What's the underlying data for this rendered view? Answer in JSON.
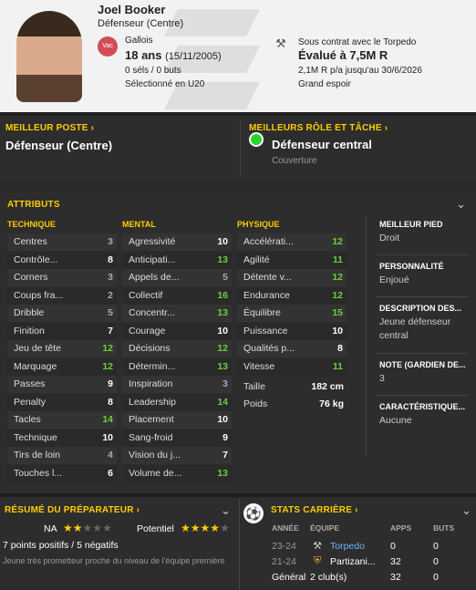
{
  "header": {
    "name": "Joel Booker",
    "position": "Défenseur (Centre)",
    "flag_label": "Vac",
    "nationality": "Gallois",
    "age": "18 ans",
    "dob": "(15/11/2005)",
    "games": "0 séls / 0 buts",
    "selection": "Sélectionné en U20",
    "contract": "Sous contrat avec le Torpedo",
    "value": "Évalué à 7,5M R",
    "wage": "2,1M R p/a jusqu'au 30/6/2026",
    "status": "Grand espoir"
  },
  "best_position": {
    "title": "MEILLEUR POSTE",
    "value": "Défenseur (Centre)"
  },
  "best_role": {
    "title": "MEILLEURS RÔLE ET TÂCHE",
    "role": "Défenseur central",
    "duty": "Couverture"
  },
  "attributes": {
    "title": "ATTRIBUTS",
    "technique": {
      "title": "TECHNIQUE",
      "rows": [
        {
          "label": "Centres",
          "value": "3",
          "tone": "grey"
        },
        {
          "label": "Contrôle...",
          "value": "8",
          "tone": "white"
        },
        {
          "label": "Corners",
          "value": "3",
          "tone": "grey"
        },
        {
          "label": "Coups fra...",
          "value": "2",
          "tone": "grey"
        },
        {
          "label": "Dribble",
          "value": "5",
          "tone": "grey"
        },
        {
          "label": "Finition",
          "value": "7",
          "tone": "white"
        },
        {
          "label": "Jeu de tête",
          "value": "12",
          "tone": "green"
        },
        {
          "label": "Marquage",
          "value": "12",
          "tone": "green"
        },
        {
          "label": "Passes",
          "value": "9",
          "tone": "white"
        },
        {
          "label": "Penalty",
          "value": "8",
          "tone": "white"
        },
        {
          "label": "Tacles",
          "value": "14",
          "tone": "green"
        },
        {
          "label": "Technique",
          "value": "10",
          "tone": "white"
        },
        {
          "label": "Tirs de loin",
          "value": "4",
          "tone": "grey"
        },
        {
          "label": "Touches l...",
          "value": "6",
          "tone": "white"
        }
      ]
    },
    "mental": {
      "title": "MENTAL",
      "rows": [
        {
          "label": "Agressivité",
          "value": "10",
          "tone": "white"
        },
        {
          "label": "Anticipati...",
          "value": "13",
          "tone": "green"
        },
        {
          "label": "Appels de...",
          "value": "5",
          "tone": "grey"
        },
        {
          "label": "Collectif",
          "value": "16",
          "tone": "green"
        },
        {
          "label": "Concentr...",
          "value": "13",
          "tone": "green"
        },
        {
          "label": "Courage",
          "value": "10",
          "tone": "white"
        },
        {
          "label": "Décisions",
          "value": "12",
          "tone": "green"
        },
        {
          "label": "Détermin...",
          "value": "13",
          "tone": "green"
        },
        {
          "label": "Inspiration",
          "value": "3",
          "tone": "grey"
        },
        {
          "label": "Leadership",
          "value": "14",
          "tone": "green"
        },
        {
          "label": "Placement",
          "value": "10",
          "tone": "white"
        },
        {
          "label": "Sang-froid",
          "value": "9",
          "tone": "white"
        },
        {
          "label": "Vision du j...",
          "value": "7",
          "tone": "white"
        },
        {
          "label": "Volume de...",
          "value": "13",
          "tone": "green"
        }
      ]
    },
    "physique": {
      "title": "PHYSIQUE",
      "rows": [
        {
          "label": "Accélérati...",
          "value": "12",
          "tone": "green"
        },
        {
          "label": "Agilité",
          "value": "11",
          "tone": "green"
        },
        {
          "label": "Détente v...",
          "value": "12",
          "tone": "green"
        },
        {
          "label": "Endurance",
          "value": "12",
          "tone": "green"
        },
        {
          "label": "Équilibre",
          "value": "15",
          "tone": "green"
        },
        {
          "label": "Puissance",
          "value": "10",
          "tone": "white"
        },
        {
          "label": "Qualités p...",
          "value": "8",
          "tone": "white"
        },
        {
          "label": "Vitesse",
          "value": "11",
          "tone": "green"
        }
      ],
      "height_label": "Taille",
      "height": "182 cm",
      "weight_label": "Poids",
      "weight": "76 kg"
    },
    "side": {
      "foot_t": "MEILLEUR PIED",
      "foot": "Droit",
      "pers_t": "PERSONNALITÉ",
      "pers": "Enjoué",
      "desc_t": "DESCRIPTION DES...",
      "desc": "Jeune défenseur central",
      "note_t": "NOTE (GARDIEN DE...",
      "note": "3",
      "car_t": "CARACTÉRISTIQUE...",
      "car": "Aucune"
    }
  },
  "coach": {
    "title": "RÉSUMÉ DU PRÉPARATEUR",
    "na": "NA",
    "na_stars": 2,
    "potential": "Potentiel",
    "potential_stars": 4,
    "points": "7 points positifs / 5 négatifs",
    "comment": "Jeune très prometteur proche du niveau de l'équipe première"
  },
  "career": {
    "title": "STATS CARRIÈRE",
    "headers": {
      "year": "ANNÉE",
      "team": "ÉQUIPE",
      "apps": "APPS",
      "goals": "BUTS"
    },
    "rows": [
      {
        "year": "23-24",
        "team": "Torpedo",
        "apps": "0",
        "goals": "0"
      },
      {
        "year": "21-24",
        "team": "Partizani...",
        "apps": "32",
        "goals": "0"
      },
      {
        "year": "Général",
        "team": "2 club(s)",
        "apps": "32",
        "goals": "0"
      }
    ]
  },
  "colors": {
    "accent": "#ffcc00",
    "good": "#6ccf3a",
    "role_dot": "#2bd12b"
  }
}
